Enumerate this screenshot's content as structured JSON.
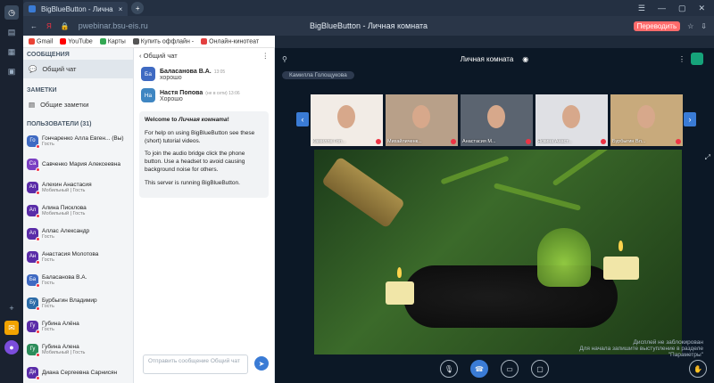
{
  "browser": {
    "tab_title": "BigBlueButton - Лична",
    "url": "pwebinar.bsu-eis.ru",
    "page_title": "BigBlueButton - Личная комната",
    "translate_label": "Переводить",
    "bookmarks": [
      {
        "label": "Gmail",
        "color": "#ea4335"
      },
      {
        "label": "YouTube",
        "color": "#ff0000"
      },
      {
        "label": "Карты",
        "color": "#34a853"
      },
      {
        "label": "Купить оффлайн -",
        "color": "#555555"
      },
      {
        "label": "Онлайн-кинотеат",
        "color": "#e34040"
      }
    ]
  },
  "left_panel": {
    "messages_title": "СООБЩЕНИЯ",
    "public_chat_label": "Общий чат",
    "notes_title": "ЗАМЕТКИ",
    "shared_notes_label": "Общие заметки",
    "users_title": "ПОЛЬЗОВАТЕЛИ (31)",
    "users": [
      {
        "initials": "Го",
        "name": "Гончаренко Алла Евген... (Вы)",
        "role": "Гость",
        "color": "#3f6ac2"
      },
      {
        "initials": "Са",
        "name": "Савченко Мария Алексеевна",
        "role": "",
        "color": "#7a3fc2"
      },
      {
        "initials": "Ал",
        "name": "Алехин Анастасия",
        "role": "Мобильный | Гость",
        "color": "#5a2ca8"
      },
      {
        "initials": "Ал",
        "name": "Алина Писклова",
        "role": "Мобильный | Гость",
        "color": "#5a2ca8"
      },
      {
        "initials": "Ал",
        "name": "Аллас Александр",
        "role": "Гость",
        "color": "#5a2ca8"
      },
      {
        "initials": "Ан",
        "name": "Анастасия Молотова",
        "role": "Гость",
        "color": "#5a2ca8"
      },
      {
        "initials": "Ба",
        "name": "Баласанова В.А.",
        "role": "Гость",
        "color": "#3f6ac2"
      },
      {
        "initials": "Бу",
        "name": "Бурбыгин Владимир",
        "role": "Гость",
        "color": "#2c6ca8"
      },
      {
        "initials": "Гу",
        "name": "Губина Алёна",
        "role": "Гость",
        "color": "#5a2ca8"
      },
      {
        "initials": "Гу",
        "name": "Губина Алена",
        "role": "Мобильный | Гость",
        "color": "#2c8c5a"
      },
      {
        "initials": "Ди",
        "name": "Диана Сергеевна Сарнисян",
        "role": "",
        "color": "#5a2ca8"
      }
    ]
  },
  "chat": {
    "back_label": "Общий чат",
    "messages": [
      {
        "initials": "Ба",
        "name": "Баласанова В.А.",
        "time": "13:05",
        "text": "хорошо",
        "color": "#3f6ac2"
      },
      {
        "initials": "На",
        "name": "Настя Попова",
        "time": "(не в сети) 13:06",
        "text": "Хорошо",
        "color": "#3f86c2"
      }
    ],
    "welcome": {
      "heading_prefix": "Welcome to ",
      "heading_room": "Личная комната",
      "heading_suffix": "!",
      "p1": "For help on using BigBlueButton see these (short) tutorial videos.",
      "p2": "To join the audio bridge click the phone button. Use a headset to avoid causing background noise for others.",
      "p3": "This server is running BigBlueButton."
    },
    "input_placeholder": "Отправить сообщение Общий чат"
  },
  "stage": {
    "title": "Личная комната",
    "presenter": "Камилла Голощукова",
    "tiles": [
      {
        "name": "Камилла Гол...",
        "bg": "#f2ece6"
      },
      {
        "name": "Михайличенк...",
        "bg": "#b8a089"
      },
      {
        "name": "Анастасия М...",
        "bg": "#5b6470"
      },
      {
        "name": "Яскина Анаст...",
        "bg": "#dfe0e4"
      },
      {
        "name": "Бурбыгин Вл...",
        "bg": "#c8aa7c"
      }
    ],
    "caption_line1": "Дисплей не заблокирован",
    "caption_line2": "Для начала запишите выступление в разделе",
    "caption_line3": "\"Параметры\""
  }
}
